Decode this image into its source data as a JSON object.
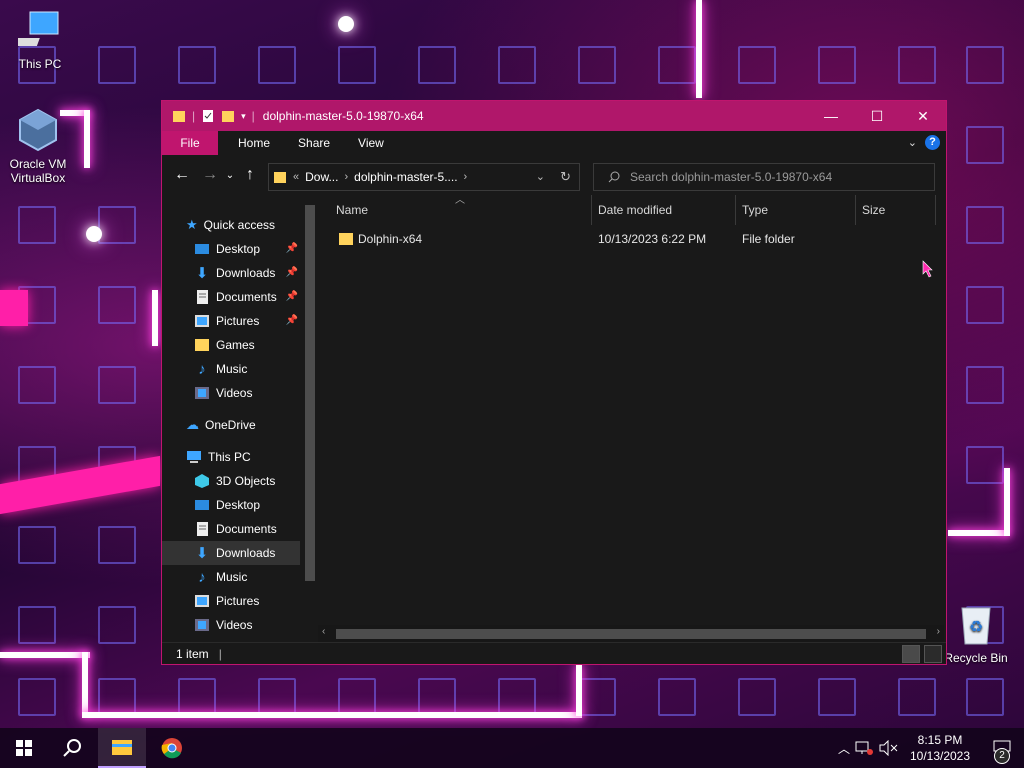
{
  "desktop": {
    "icons": [
      {
        "label": "This PC"
      },
      {
        "label": "Oracle VM VirtualBox"
      },
      {
        "label": "Recycle Bin"
      }
    ]
  },
  "window": {
    "title": "dolphin-master-5.0-19870-x64",
    "controls": {
      "minimize": "—",
      "maximize": "☐",
      "close": "✕"
    },
    "ribbon_tabs": [
      "File",
      "Home",
      "Share",
      "View"
    ],
    "address": {
      "overflow": "«",
      "segments": [
        "Dow...",
        "dolphin-master-5...."
      ]
    },
    "search": {
      "placeholder": "Search dolphin-master-5.0-19870-x64"
    },
    "nav": {
      "quick_access": "Quick access",
      "quick_items": [
        "Desktop",
        "Downloads",
        "Documents",
        "Pictures",
        "Games",
        "Music",
        "Videos"
      ],
      "onedrive": "OneDrive",
      "this_pc": "This PC",
      "pc_items": [
        "3D Objects",
        "Desktop",
        "Documents",
        "Downloads",
        "Music",
        "Pictures",
        "Videos"
      ],
      "selected": "Downloads"
    },
    "columns": [
      "Name",
      "Date modified",
      "Type",
      "Size"
    ],
    "files": [
      {
        "name": "Dolphin-x64",
        "date": "10/13/2023 6:22 PM",
        "type": "File folder",
        "size": ""
      }
    ],
    "status": "1 item"
  },
  "taskbar": {
    "time": "8:15 PM",
    "date": "10/13/2023",
    "notifications": "2"
  },
  "colors": {
    "accent": "#b0176a",
    "window_bg": "#191919"
  }
}
